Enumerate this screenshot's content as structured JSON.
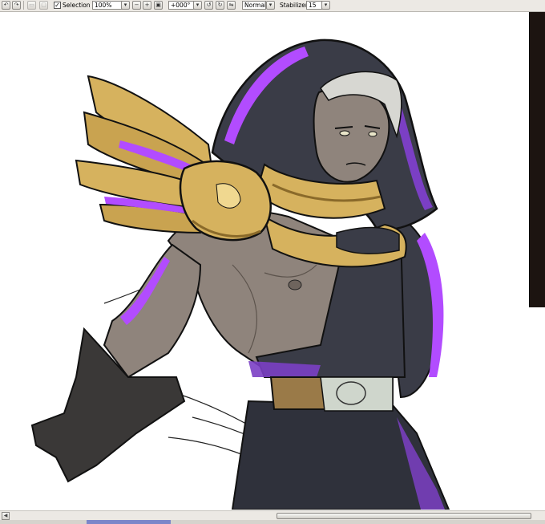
{
  "toolbar": {
    "selection_label": "Selection",
    "selection_checked": true,
    "zoom_value": "100%",
    "rotation_value": "+000°",
    "blend_mode": "Normal",
    "stabilizer_label": "Stabilizer",
    "stabilizer_value": "15",
    "icons": [
      "undo-icon",
      "redo-icon",
      "deselect-icon",
      "clear-icon",
      "zoom-dropdown-icon",
      "zoom-out-icon",
      "zoom-in-icon",
      "zoom-reset-icon",
      "rotate-dropdown-icon",
      "rotate-left-icon",
      "rotate-right-icon",
      "rotate-reset-icon",
      "flip-icon",
      "stabilizer-dropdown-icon"
    ]
  },
  "canvas": {
    "background": "#ffffff",
    "artwork_colors": {
      "skin": "#8f847c",
      "hood": "#3a3c47",
      "purple_rim": "#b24cff",
      "gold": "#d6b25e",
      "gold_dark": "#8a6a2a",
      "hair": "#d7d7d2",
      "glove": "#3a3837",
      "belt": "#9a7a48",
      "belt_cloth": "#cfd6cc"
    }
  },
  "scrollbar": {
    "left_arrow": "◀"
  }
}
